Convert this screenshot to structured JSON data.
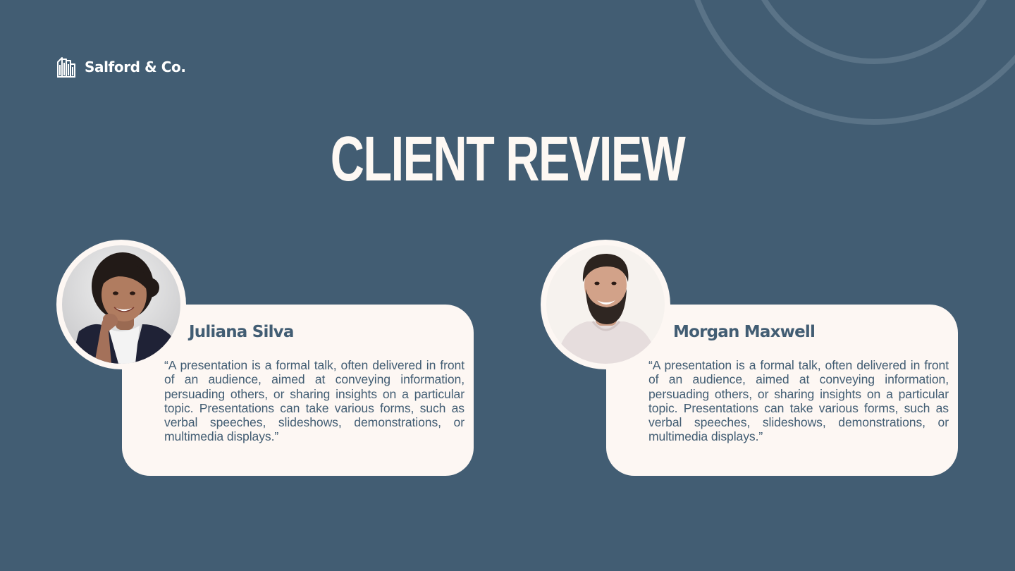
{
  "brand": {
    "name": "Salford & Co.",
    "icon": "building-columns-icon"
  },
  "title": "CLIENT REVIEW",
  "colors": {
    "background": "#425d73",
    "card": "#fdf7f3",
    "accent_text": "#425d73",
    "title_text": "#fdf8f3"
  },
  "reviews": [
    {
      "name": "Juliana Silva",
      "quote": "“A presentation is a formal talk, often delivered in front of an audience, aimed at conveying information, persuading others, or sharing insights on a particular topic. Presentations can take various forms, such as verbal speeches, slideshows, demonstrations, or multimedia displays.”",
      "avatar_icon": "woman-portrait-photo"
    },
    {
      "name": "Morgan Maxwell",
      "quote": "“A presentation is a formal talk, often delivered in front of an audience, aimed at conveying information, persuading others, or sharing insights on a particular topic. Presentations can take various forms, such as verbal speeches, slideshows, demonstrations, or multimedia displays.”",
      "avatar_icon": "man-portrait-photo"
    }
  ]
}
